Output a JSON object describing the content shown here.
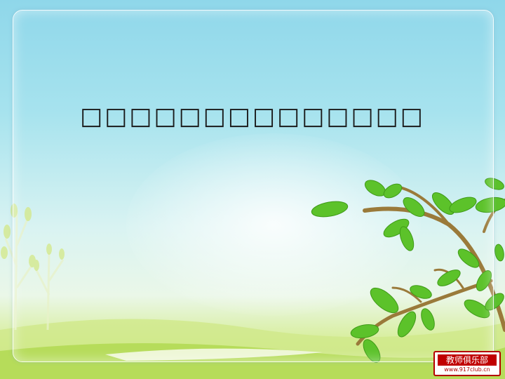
{
  "slide": {
    "title": "□□□□□□□□□□□□□□"
  },
  "logo": {
    "name": "教师俱乐部",
    "url": "www.917club.cn"
  }
}
